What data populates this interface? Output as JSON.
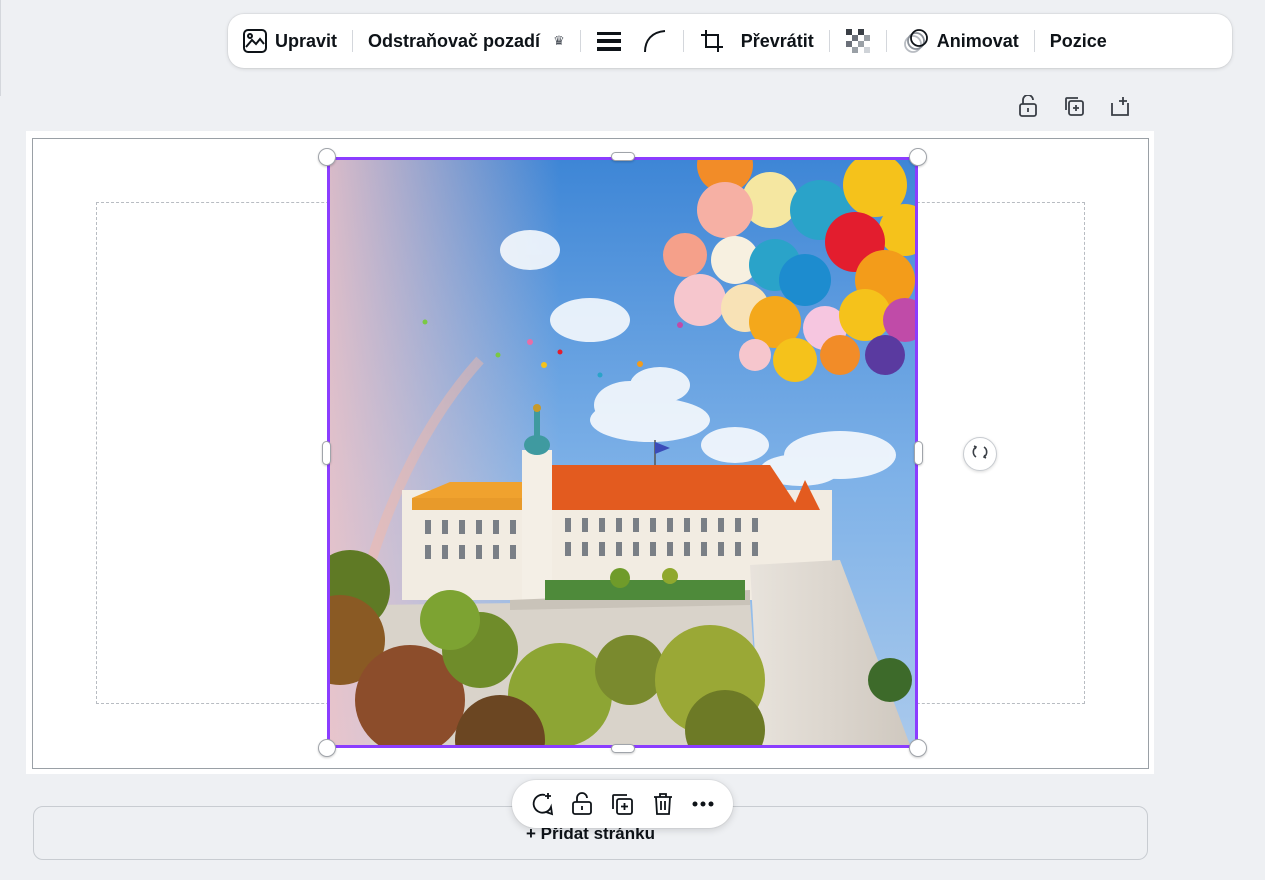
{
  "toolbar": {
    "edit_label": "Upravit",
    "bg_remover_label": "Odstraňovač pozadí",
    "flip_label": "Převrátit",
    "animate_label": "Animovat",
    "position_label": "Pozice",
    "icons": [
      "edit-image-icon",
      "crown-icon",
      "border-style-icon",
      "corner-rounding-icon",
      "crop-icon",
      "transparency-icon",
      "animate-icon"
    ]
  },
  "page_actions": {
    "icons": [
      "lock-icon",
      "duplicate-page-icon",
      "add-page-icon"
    ]
  },
  "canvas": {
    "image_name": "castle-with-balloons-image",
    "selection_color": "#8b3dff"
  },
  "context_toolbar": {
    "icons": [
      "comment-icon",
      "lock-icon",
      "duplicate-icon",
      "delete-icon",
      "more-icon"
    ]
  },
  "add_page": {
    "label": "+ Přidat stránku"
  },
  "colors": {
    "background": "#eef0f3",
    "accent": "#8b3dff",
    "text": "#0e1318"
  }
}
